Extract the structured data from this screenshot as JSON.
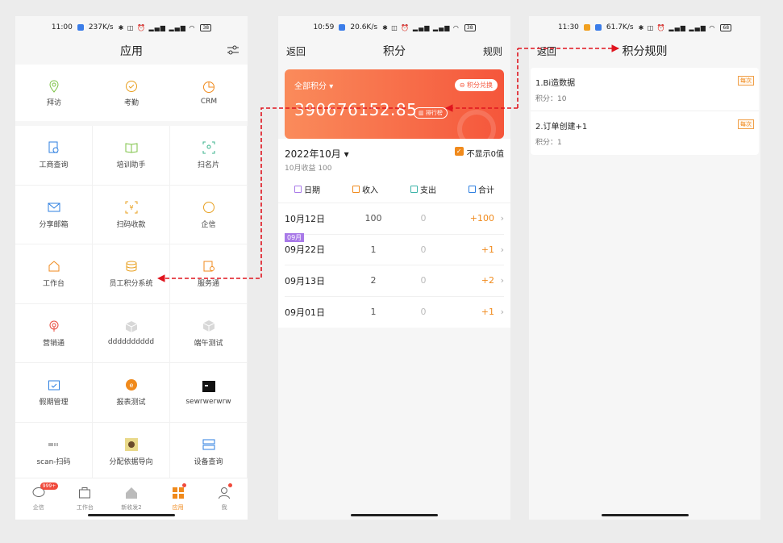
{
  "screens": {
    "apps": {
      "status": {
        "time": "11:00",
        "speed": "237K/s",
        "battery": "38"
      },
      "title": "应用",
      "top_apps": [
        "拜访",
        "考勤",
        "CRM"
      ],
      "grid": [
        "工商查询",
        "培训助手",
        "扫名片",
        "分享邮箱",
        "扫码收款",
        "企信",
        "工作台",
        "员工积分系统",
        "服务通",
        "营销通",
        "dddddddddd",
        "端午测试",
        "假期管理",
        "报表测试",
        "sewrwerwrw",
        "scan-扫码",
        "分配依据导向",
        "设备查询"
      ],
      "tabs": [
        "企信",
        "工作台",
        "新收发2",
        "应用",
        "我"
      ],
      "badge": "999+"
    },
    "points": {
      "status": {
        "time": "10:59",
        "speed": "20.6K/s",
        "battery": "38"
      },
      "back": "返回",
      "title": "积分",
      "rules": "规则",
      "card": {
        "label": "全部积分",
        "total": "390676152.85",
        "exchange": "积分兑换",
        "rank": "排行榜"
      },
      "month": "2022年10月",
      "month_sub": "10月收益 100",
      "hide_zero": "不显示0值",
      "headers": [
        "日期",
        "收入",
        "支出",
        "合计"
      ],
      "month_tag": "09月",
      "rows": [
        {
          "date": "10月12日",
          "income": "100",
          "expense": "0",
          "total": "+100"
        },
        {
          "date": "09月22日",
          "income": "1",
          "expense": "0",
          "total": "+1"
        },
        {
          "date": "09月13日",
          "income": "2",
          "expense": "0",
          "total": "+2"
        },
        {
          "date": "09月01日",
          "income": "1",
          "expense": "0",
          "total": "+1"
        }
      ]
    },
    "rules": {
      "status": {
        "time": "11:30",
        "speed": "61.7K/s",
        "battery": "68"
      },
      "back": "返回",
      "title": "积分规则",
      "items": [
        {
          "title": "1.Bi造数据",
          "score": "积分：10",
          "tag": "每次"
        },
        {
          "title": "2.订单创建+1",
          "score": "积分：1",
          "tag": "每次"
        }
      ]
    }
  },
  "colors": {
    "accent": "#f08a1c",
    "arrow": "#e0141e",
    "card_start": "#fa8b5b",
    "card_end": "#f5563b"
  }
}
